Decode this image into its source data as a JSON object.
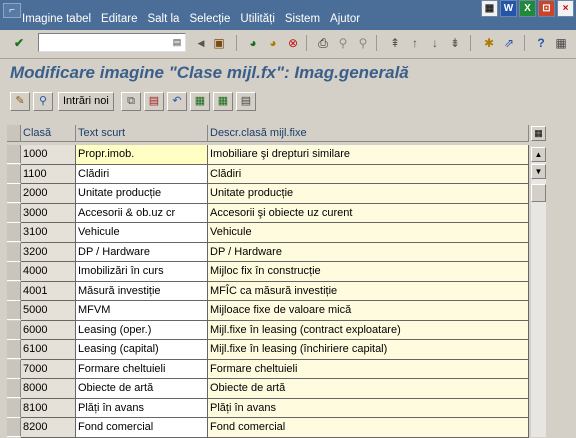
{
  "menu": {
    "items": [
      "Imagine tabel",
      "Editare",
      "Salt la",
      "Selecție",
      "Utilități",
      "Sistem",
      "Ajutor"
    ]
  },
  "toolbar": {
    "command_value": "",
    "icons": [
      "enter-icon",
      "save-icon",
      "back-icon",
      "exit-icon",
      "cancel-icon",
      "print-icon",
      "find-icon",
      "find-next-icon",
      "first-page-icon",
      "previous-page-icon",
      "next-page-icon",
      "last-page-icon",
      "create-session-icon",
      "shortcut-icon",
      "help-icon",
      "layout-icon"
    ]
  },
  "title": "Modificare imagine \"Clase mijl.fx\": Imag.generală",
  "app_toolbar": {
    "new_entries_label": "Intrări noi"
  },
  "table": {
    "columns": [
      "Clasă",
      "Text scurt",
      "Descr.clasă mijl.fixe"
    ],
    "rows": [
      [
        "1000",
        "Propr.imob.",
        "Imobiliare şi drepturi similare"
      ],
      [
        "1100",
        "Clădiri",
        "Clădiri"
      ],
      [
        "2000",
        "Unitate producție",
        "Unitate producție"
      ],
      [
        "3000",
        "Accesorii & ob.uz cr",
        "Accesorii şi obiecte uz curent"
      ],
      [
        "3100",
        "Vehicule",
        "Vehicule"
      ],
      [
        "3200",
        "DP / Hardware",
        "DP / Hardware"
      ],
      [
        "4000",
        "Imobilizări în curs",
        "Mijloc  fix în construcție"
      ],
      [
        "4001",
        "Măsură investiție",
        "MFÎC ca măsură investiție"
      ],
      [
        "5000",
        "MFVM",
        "Mijloace fixe de valoare mică"
      ],
      [
        "6000",
        "Leasing (oper.)",
        "Mijl.fixe în leasing (contract exploatare)"
      ],
      [
        "6100",
        "Leasing (capital)",
        "Mijl.fixe în leasing (închiriere capital)"
      ],
      [
        "7000",
        "Formare cheltuieli",
        "Formare cheltuieli"
      ],
      [
        "8000",
        "Obiecte de artă",
        "Obiecte de artă"
      ],
      [
        "8100",
        "Plăți în avans",
        "Plăți în avans"
      ],
      [
        "8200",
        "Fond comercial",
        "Fond comercial"
      ]
    ]
  },
  "colors": {
    "menubar": "#4b6e99",
    "title": "#3a5f8a",
    "key_cell": "#e5e1d8",
    "desc_cell": "#fffbdf",
    "focus_cell": "#ffffc4"
  }
}
